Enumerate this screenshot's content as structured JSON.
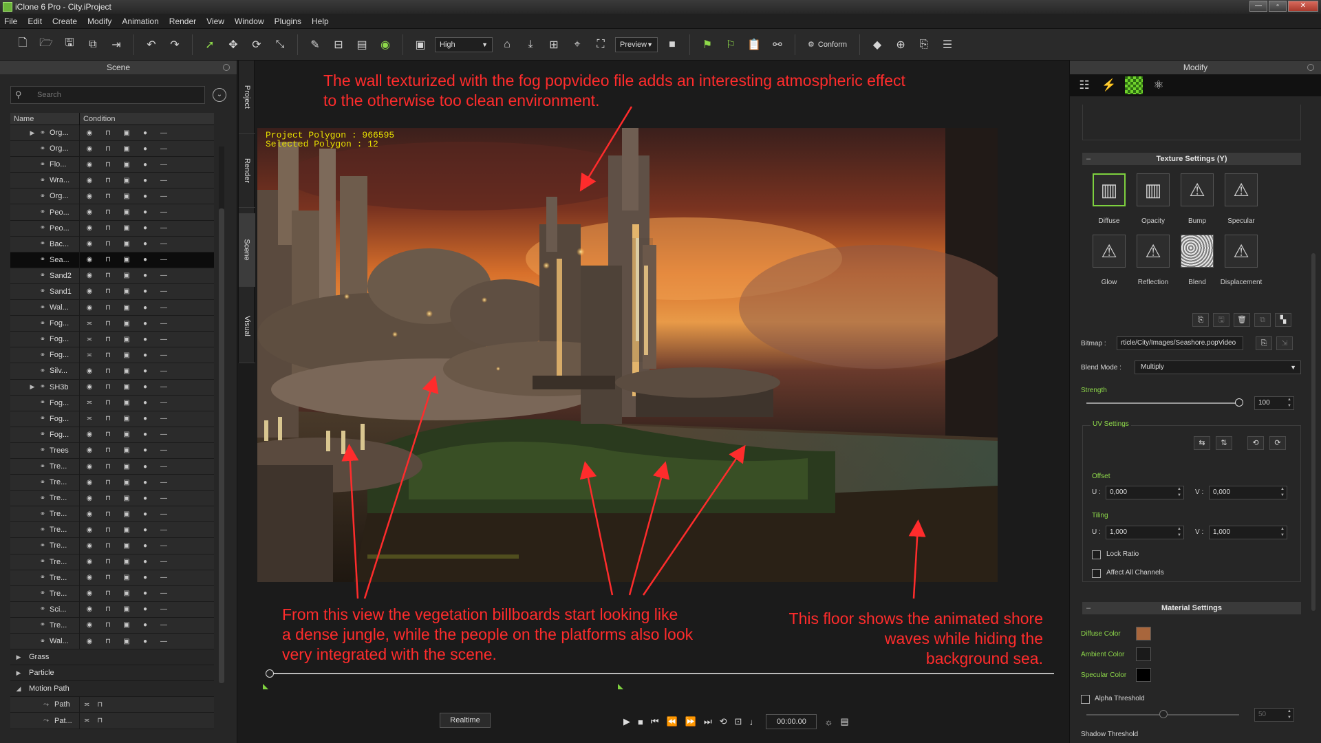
{
  "window": {
    "title": "iClone 6 Pro - City.iProject"
  },
  "menu": [
    "File",
    "Edit",
    "Create",
    "Modify",
    "Animation",
    "Render",
    "View",
    "Window",
    "Plugins",
    "Help"
  ],
  "toolbar": {
    "quality": "High",
    "preview": "Preview",
    "conform": "Conform"
  },
  "scene": {
    "title": "Scene",
    "search_placeholder": "Search",
    "col_name": "Name",
    "col_condition": "Condition",
    "rows": [
      {
        "label": "Org...",
        "expand": "▶",
        "vis": "eye"
      },
      {
        "label": "Org...",
        "expand": "",
        "vis": "eye"
      },
      {
        "label": "Flo...",
        "expand": "",
        "vis": "eye"
      },
      {
        "label": "Wra...",
        "expand": "",
        "vis": "eye"
      },
      {
        "label": "Org...",
        "expand": "",
        "vis": "eye"
      },
      {
        "label": "Peo...",
        "expand": "",
        "vis": "eye"
      },
      {
        "label": "Peo...",
        "expand": "",
        "vis": "eye"
      },
      {
        "label": "Bac...",
        "expand": "",
        "vis": "eye"
      },
      {
        "label": "Sea...",
        "expand": "",
        "vis": "eye",
        "selected": true
      },
      {
        "label": "Sand2",
        "expand": "",
        "vis": "eye"
      },
      {
        "label": "Sand1",
        "expand": "",
        "vis": "eye"
      },
      {
        "label": "Wal...",
        "expand": "",
        "vis": "eye"
      },
      {
        "label": "Fog...",
        "expand": "",
        "vis": "closed"
      },
      {
        "label": "Fog...",
        "expand": "",
        "vis": "closed"
      },
      {
        "label": "Fog...",
        "expand": "",
        "vis": "closed"
      },
      {
        "label": "Silv...",
        "expand": "",
        "vis": "eye"
      },
      {
        "label": "SH3b",
        "expand": "▶",
        "vis": "eye"
      },
      {
        "label": "Fog...",
        "expand": "",
        "vis": "closed"
      },
      {
        "label": "Fog...",
        "expand": "",
        "vis": "closed"
      },
      {
        "label": "Fog...",
        "expand": "",
        "vis": "eye"
      },
      {
        "label": "Trees",
        "expand": "",
        "vis": "eye"
      },
      {
        "label": "Tre...",
        "expand": "",
        "vis": "eye"
      },
      {
        "label": "Tre...",
        "expand": "",
        "vis": "eye"
      },
      {
        "label": "Tre...",
        "expand": "",
        "vis": "eye"
      },
      {
        "label": "Tre...",
        "expand": "",
        "vis": "eye"
      },
      {
        "label": "Tre...",
        "expand": "",
        "vis": "eye"
      },
      {
        "label": "Tre...",
        "expand": "",
        "vis": "eye"
      },
      {
        "label": "Tre...",
        "expand": "",
        "vis": "eye"
      },
      {
        "label": "Tre...",
        "expand": "",
        "vis": "eye"
      },
      {
        "label": "Tre...",
        "expand": "",
        "vis": "eye"
      },
      {
        "label": "Sci...",
        "expand": "",
        "vis": "eye"
      },
      {
        "label": "Tre...",
        "expand": "",
        "vis": "eye"
      },
      {
        "label": "Wal...",
        "expand": "",
        "vis": "eye"
      }
    ],
    "groups": [
      {
        "label": "Grass",
        "expand": "▶"
      },
      {
        "label": "Particle",
        "expand": "▶"
      },
      {
        "label": "Motion Path",
        "expand": "◢"
      }
    ],
    "paths": [
      {
        "label": "Path"
      },
      {
        "label": "Pat..."
      }
    ]
  },
  "side_tabs": [
    "Project",
    "Render",
    "Scene",
    "Visual"
  ],
  "viewport": {
    "stats_polygon": "Project Polygon : 966595",
    "stats_selected": "Selected Polygon : 12",
    "annotation_top": [
      "The wall texturized with the fog popvideo file adds an interesting atmospheric effect",
      "to the otherwise too clean environment."
    ],
    "annotation_left": [
      "From this view the vegetation billboards start looking like",
      "a dense jungle, while the people on the platforms also look",
      "very integrated with the scene."
    ],
    "annotation_right": [
      "This floor shows the animated shore",
      "waves while hiding the",
      "background sea."
    ]
  },
  "playback": {
    "realtime": "Realtime",
    "time": "00:00.00"
  },
  "modify": {
    "title": "Modify",
    "texture_title": "Texture Settings  (Y)",
    "channels": [
      "Diffuse",
      "Opacity",
      "Bump",
      "Specular",
      "Glow",
      "Reflection",
      "Blend",
      "Displacement"
    ],
    "bitmap_label": "Bitmap :",
    "bitmap_value": "rticle/City/Images/Seashore.popVideo",
    "blend_mode_label": "Blend Mode :",
    "blend_mode_value": "Multiply",
    "strength_label": "Strength",
    "strength_value": "100",
    "uv_title": "UV Settings",
    "offset_label": "Offset",
    "u_label": "U :",
    "v_label": "V :",
    "offset_u": "0,000",
    "offset_v": "0,000",
    "tiling_label": "Tiling",
    "tiling_u": "1,000",
    "tiling_v": "1,000",
    "lock_ratio": "Lock Ratio",
    "affect_all": "Affect All Channels",
    "material_title": "Material Settings",
    "diffuse_color": "Diffuse Color",
    "ambient_color": "Ambient Color",
    "specular_color": "Specular Color",
    "alpha_threshold": "Alpha Threshold",
    "alpha_value": "50",
    "shadow_threshold": "Shadow Threshold"
  },
  "colors": {
    "annotation": "#ff2c2c",
    "accent_green": "#7ed13f",
    "diffuse_swatch": "#a8663c",
    "ambient_swatch": "#1a1a1a",
    "specular_swatch": "#000000"
  }
}
